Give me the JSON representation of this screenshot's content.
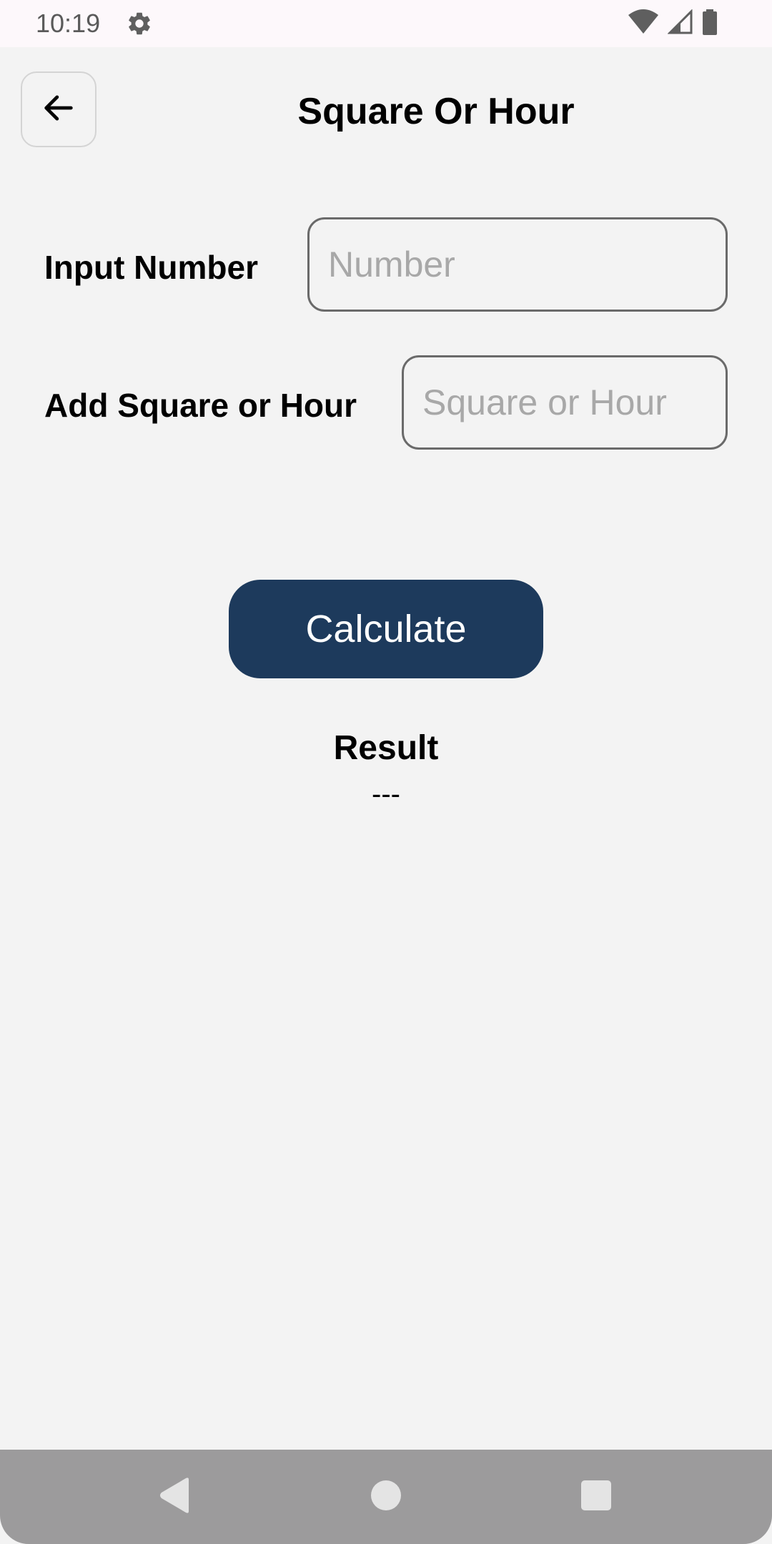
{
  "status_bar": {
    "time": "10:19",
    "icons": [
      "gear-icon",
      "wifi-icon",
      "cell-signal-icon",
      "battery-icon"
    ]
  },
  "header": {
    "title": "Square Or Hour",
    "back_icon": "arrow-left-icon"
  },
  "form": {
    "number_label": "Input Number",
    "number_placeholder": "Number",
    "number_value": "",
    "square_hour_label": "Add Square or Hour",
    "square_hour_placeholder": "Square or Hour",
    "square_hour_value": ""
  },
  "actions": {
    "calculate_label": "Calculate"
  },
  "result": {
    "label": "Result",
    "value": "---"
  },
  "nav_bar": {
    "icons": [
      "back-triangle-icon",
      "home-circle-icon",
      "recents-square-icon"
    ]
  },
  "colors": {
    "background": "#f3f3f3",
    "accent": "#1d3a5c",
    "nav_bar": "#9c9b9c",
    "status_bar": "#fdf8fb"
  }
}
